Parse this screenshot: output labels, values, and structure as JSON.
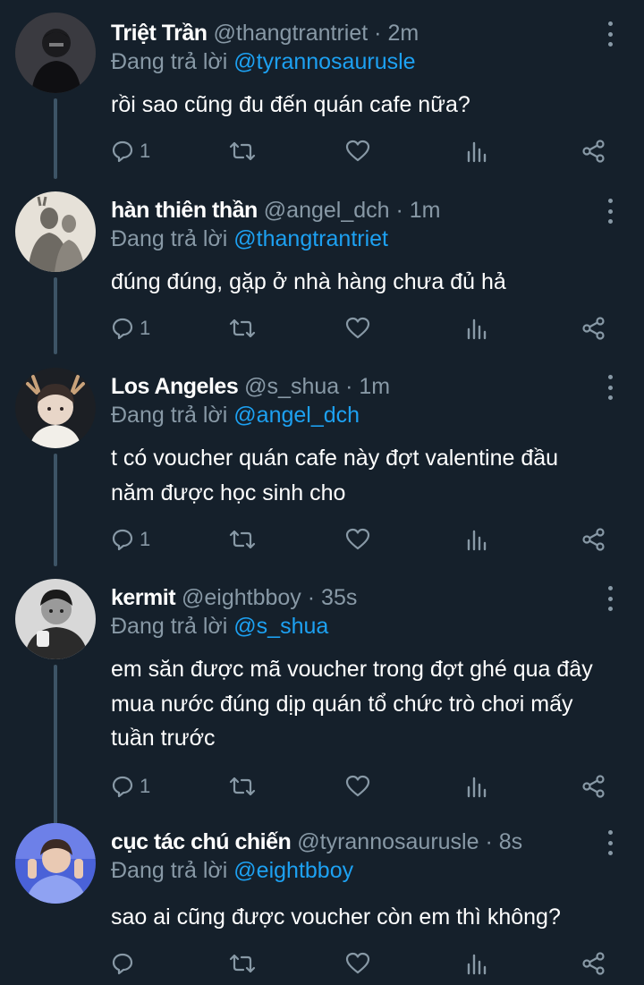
{
  "tweets": [
    {
      "name": "Triệt Trần",
      "handle": "@thangtrantriet",
      "time": "2m",
      "reply_prefix": "Đang trả lời",
      "reply_to": "@tyrannosaurusle",
      "lines": [
        "rồi sao cũng đu đến quán cafe nữa?"
      ],
      "reply_count": "1"
    },
    {
      "name": "hàn thiên thần",
      "handle": "@angel_dch",
      "time": "1m",
      "reply_prefix": "Đang trả lời",
      "reply_to": "@thangtrantriet",
      "lines": [
        "đúng đúng, gặp ở nhà hàng chưa đủ hả"
      ],
      "reply_count": "1"
    },
    {
      "name": "Los Angeles",
      "handle": "@s_shua",
      "time": "1m",
      "reply_prefix": "Đang trả lời",
      "reply_to": "@angel_dch",
      "lines": [
        "t có voucher quán cafe này đợt valentine đầu",
        "năm được học sinh cho"
      ],
      "reply_count": "1"
    },
    {
      "name": "kermit",
      "handle": "@eightbboy",
      "time": "35s",
      "reply_prefix": "Đang trả lời",
      "reply_to": "@s_shua",
      "lines": [
        "em săn được mã voucher trong đợt ghé qua đây",
        "mua nước đúng dịp quán tổ chức trò chơi mấy",
        "tuần trước"
      ],
      "reply_count": "1"
    },
    {
      "name": "cục tác chú chiến",
      "handle": "@tyrannosaurusle",
      "time": "8s",
      "reply_prefix": "Đang trả lời",
      "reply_to": "@eightbboy",
      "lines": [
        "sao ai cũng được voucher còn em thì không?"
      ],
      "reply_count": ""
    }
  ],
  "icons": {
    "reply": "reply-bubble-icon",
    "retweet": "retweet-icon",
    "like": "heart-icon",
    "analytics": "analytics-bar-icon",
    "share": "share-icon",
    "more": "more-vertical-icon"
  },
  "colors": {
    "background": "#15202b",
    "secondary_text": "#8899a6",
    "link": "#1da1f2",
    "thread_line": "#3d5466"
  }
}
